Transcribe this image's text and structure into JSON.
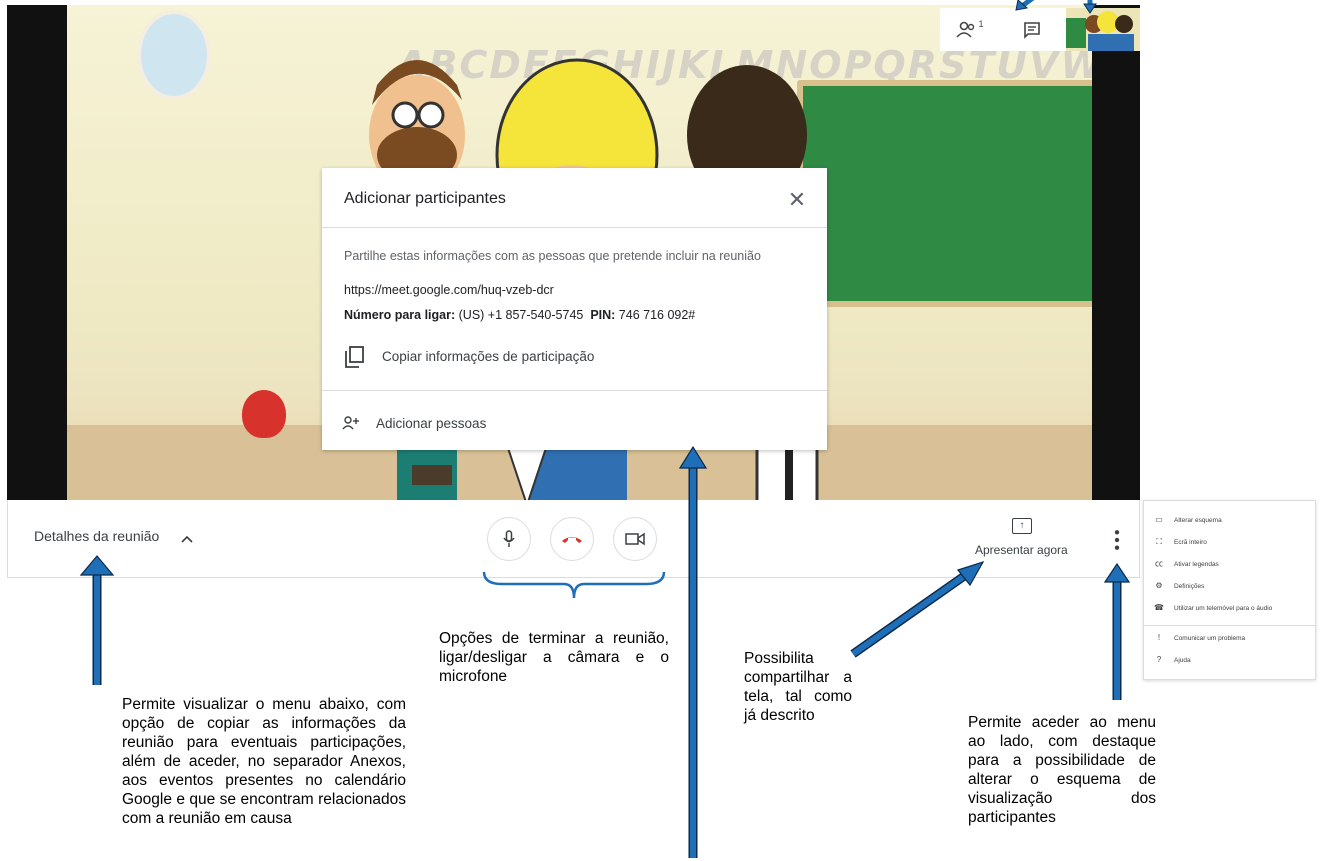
{
  "dialog": {
    "title": "Adicionar participantes",
    "close_icon": "close-icon",
    "description": "Partilhe estas informações com as pessoas que pretende incluir na reunião",
    "link": "https://meet.google.com/huq-vzeb-dcr",
    "phone_label": "Número para ligar:",
    "phone_value": "(US) +1 857-540-5745",
    "pin_label": "PIN:",
    "pin_value": "746 716 092#",
    "copy_label": "Copiar informações de participação",
    "add_label": "Adicionar pessoas"
  },
  "scene": {
    "alphabet": "ABCDEFGHIJKLMNOPQRSTUVWXYZ"
  },
  "topbar": {
    "participants_icon": "people-icon",
    "participant_count": "1",
    "chat_icon": "chat-icon"
  },
  "bottombar": {
    "details_label": "Detalhes da reunião",
    "details_icon": "chevron-up-icon",
    "mic_icon": "microphone-icon",
    "end_call_icon": "hang-up-icon",
    "camera_icon": "video-camera-icon",
    "present_label": "Apresentar agora",
    "present_icon": "present-screen-icon",
    "more_icon": "more-vertical-icon"
  },
  "menu": {
    "items": [
      {
        "label": "Alterar esquema",
        "icon": "layout-icon"
      },
      {
        "label": "Ecrã inteiro",
        "icon": "fullscreen-icon"
      },
      {
        "label": "Ativar legendas",
        "icon": "captions-icon"
      },
      {
        "label": "Definições",
        "icon": "settings-icon"
      },
      {
        "label": "Utilizar um telemóvel para o áudio",
        "icon": "phone-icon"
      },
      {
        "label": "Comunicar um problema",
        "icon": "report-problem-icon"
      },
      {
        "label": "Ajuda",
        "icon": "help-icon"
      }
    ]
  },
  "annotations": {
    "details_note": "Permite visualizar o menu abaixo, com opção de copiar as informações da reunião para eventuais participações, além de aceder, no separador Anexos, aos eventos presentes no calendário Google e que se encontram relacionados com a reunião em causa",
    "controls_note": "Opções de terminar a reunião, ligar/desligar a câmara e o microfone",
    "present_note": "Possibilita compartilhar a tela, tal como já descrito",
    "more_note": "Permite aceder ao menu ao lado, com destaque para a possibilidade de alterar o esquema de visualização dos participantes"
  },
  "colors": {
    "arrow": "#1f6fb8",
    "arrow_outline": "#0b2a4a",
    "end_call": "#d93025",
    "board": "#2f8a44"
  }
}
